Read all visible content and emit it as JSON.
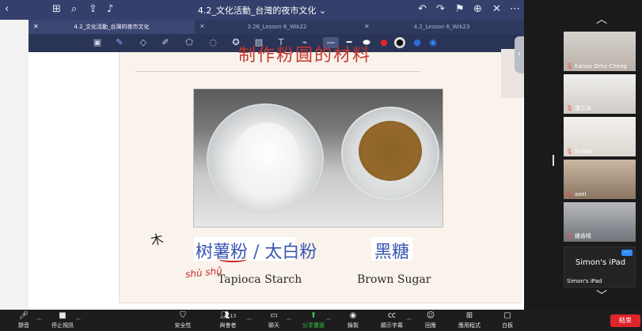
{
  "goodnotes": {
    "doc_title": "4.2_文化活動_台灣的夜市文化 ⌄",
    "tabs": [
      {
        "label": "4.2_文化活動_台灣的夜市文化"
      },
      {
        "label": "3.26_Lesson 6_Wik22"
      },
      {
        "label": "4.2_Lesson 6_Wik23"
      }
    ]
  },
  "slide": {
    "title": "制作粉圓的材料",
    "label1_cjk": "树薯粉 / 太白粉",
    "label1_en": "Tapioca Starch",
    "label2_cjk": "黑糖",
    "label2_en": "Brown Sugar",
    "pinyin_note": "shù shǔ",
    "hand_mark": "木"
  },
  "participants": [
    {
      "name": "Kanna Ortiz-Cheng"
    },
    {
      "name": "潘立泳"
    },
    {
      "name": "Yo-Wei"
    },
    {
      "name": "axel"
    },
    {
      "name": "鍾香晴"
    }
  ],
  "ipad_tile": {
    "title": "Simon's iPad",
    "subtitle": "Simon's iPad"
  },
  "controls": {
    "mute": "靜音",
    "stop_video": "停止視訊",
    "security": "安全性",
    "participants": "與會者",
    "participants_count": "13",
    "chat": "聊天",
    "share": "分享畫面",
    "record": "錄製",
    "captions": "顯示字幕",
    "reactions": "回應",
    "apps": "應用程式",
    "whiteboard": "白板",
    "end": "結束"
  }
}
